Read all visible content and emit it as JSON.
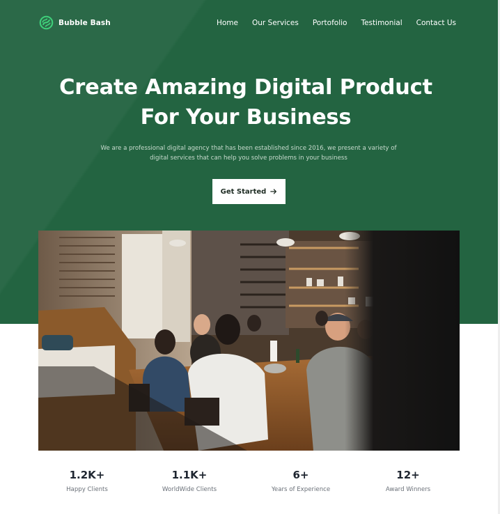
{
  "brand": {
    "name": "Bubble Bash",
    "logo_icon": "leaf-swirl-icon",
    "accent": "#3fcf7a"
  },
  "nav": {
    "items": [
      "Home",
      "Our Services",
      "Portofolio",
      "Testimonial",
      "Contact Us"
    ]
  },
  "hero": {
    "title_line1": "Create Amazing Digital Product",
    "title_line2": "For Your Business",
    "subtitle_line1": "We are a professional digital agency that has been established since 2016, we present a variety of",
    "subtitle_line2": "digital services that can help you solve problems in your business",
    "cta_label": "Get Started",
    "cta_icon": "arrow-right-icon",
    "background": "#236441"
  },
  "image": {
    "subject": "team meeting photo"
  },
  "stats": [
    {
      "value": "1.2K+",
      "label": "Happy Clients"
    },
    {
      "value": "1.1K+",
      "label": "WorldWide Clients"
    },
    {
      "value": "6+",
      "label": "Years of Experience"
    },
    {
      "value": "12+",
      "label": "Award Winners"
    }
  ]
}
